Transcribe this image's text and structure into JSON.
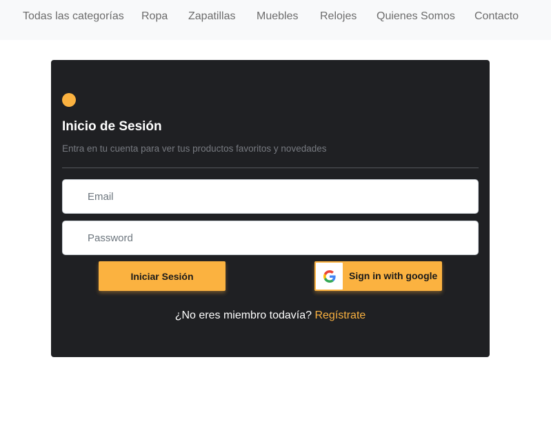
{
  "nav": {
    "items": [
      {
        "label": "Todas las categorías"
      },
      {
        "label": "Ropa"
      },
      {
        "label": "Zapatillas"
      },
      {
        "label": "Muebles"
      },
      {
        "label": "Relojes"
      },
      {
        "label": "Quienes Somos"
      },
      {
        "label": "Contacto"
      }
    ]
  },
  "login": {
    "title": "Inicio de Sesión",
    "subtitle": "Entra en tu cuenta para ver tus productos favoritos y novedades",
    "email_placeholder": "Email",
    "password_placeholder": "Password",
    "login_button": "Iniciar Sesión",
    "google_button": "Sign in with google",
    "signup_prompt": "¿No eres miembro todavía?",
    "signup_link": "Regístrate"
  },
  "colors": {
    "accent": "#fbb240",
    "card_bg": "#1f2023",
    "nav_bg": "#f8f9fa"
  },
  "icons": {
    "logo_dot": "accent-dot-icon",
    "google": "google-g-icon"
  }
}
